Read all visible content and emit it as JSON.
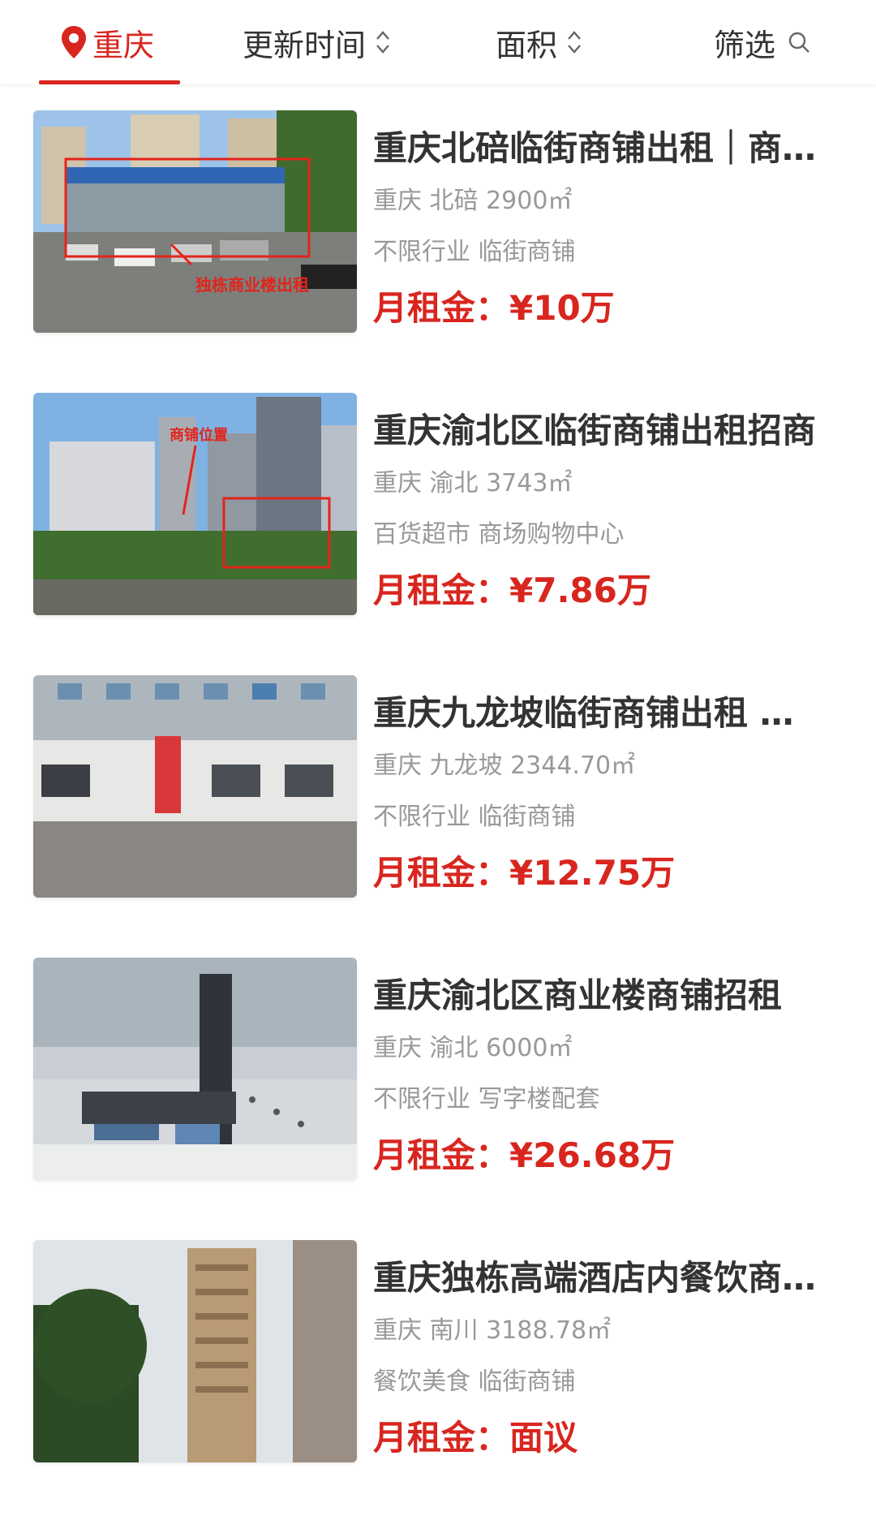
{
  "filter_bar": {
    "city": "重庆",
    "update_time": "更新时间",
    "area": "面积",
    "filter": "筛选"
  },
  "price_label": "月租金：",
  "listings": [
    {
      "title": "重庆北碚临街商铺出租｜商业楼整栋出租",
      "location": "重庆 北碚 2900㎡",
      "tags": "不限行业 临街商铺",
      "price": "¥10万",
      "image_text": "独栋商业楼出租"
    },
    {
      "title": "重庆渝北区临街商铺出租招商",
      "location": "重庆 渝北 3743㎡",
      "tags": "百货超市 商场购物中心",
      "price": "¥7.86万",
      "image_text": "商铺位置"
    },
    {
      "title": "重庆九龙坡临街商铺出租 整层招租",
      "location": "重庆 九龙坡 2344.70㎡",
      "tags": "不限行业 临街商铺",
      "price": "¥12.75万",
      "image_text": ""
    },
    {
      "title": "重庆渝北区商业楼商铺招租",
      "location": "重庆 渝北 6000㎡",
      "tags": "不限行业 写字楼配套",
      "price": "¥26.68万",
      "image_text": ""
    },
    {
      "title": "重庆独栋高端酒店内餐饮商铺出租",
      "location": "重庆 南川 3188.78㎡",
      "tags": "餐饮美食 临街商铺",
      "price": "面议",
      "image_text": ""
    }
  ],
  "colors": {
    "accent": "#d8261f",
    "title": "#333333",
    "meta": "#999999"
  },
  "icons": [
    "location-pin-icon",
    "sort-icon",
    "search-icon"
  ]
}
